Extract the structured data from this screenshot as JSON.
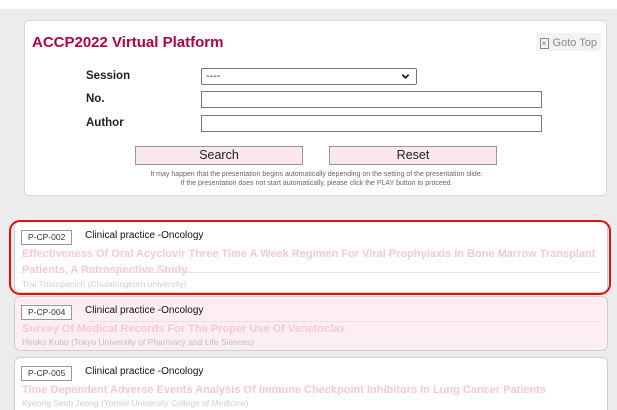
{
  "header": {
    "title": "ACCP2022 Virtual Platform",
    "goto_top": "Goto Top"
  },
  "search_form": {
    "session_label": "Session",
    "session_value": "----",
    "no_label": "No.",
    "no_value": "",
    "author_label": "Author",
    "author_value": "",
    "search_button": "Search",
    "reset_button": "Reset",
    "note_line1": "It may happen that the presentation begins automatically depending on the setting of the presentation slide.",
    "note_line2": "If the presentation does not start automatically, please click the PLAY button to proceed."
  },
  "results": [
    {
      "code": "P-CP-002",
      "category": "Clinical practice -Oncology",
      "title": "Effectiveness Of Oral Acyclovir Three Time A Week Regimen For Viral Prophylaxis In Bone Marrow Transplant Patients, A Retrospective Study.",
      "author": "Trai Thampanich  (Chulalongkorn university)",
      "highlighted": true
    },
    {
      "code": "P-CP-004",
      "category": "Clinical practice -Oncology",
      "title": "Survey Of Medical Records For The Proper Use Of Venetoclax",
      "author": "Hiroko Kubo  (Tokyo University of Pharmacy and Life Siences)",
      "highlighted": false
    },
    {
      "code": "P-CP-005",
      "category": "Clinical practice -Oncology",
      "title": "Time Dependent Adverse Events Analysis Of Immune Checkpoint Inhibitors In Lung Cancer Patients",
      "author": "Kyeong Seob Jeong  (Yonsei University College of Medicine)",
      "highlighted": false
    }
  ],
  "colors": {
    "brand": "#b3004b",
    "title_pink": "#f7c8d8",
    "button_bg": "#fbe7ef",
    "highlight_red": "#e01010"
  }
}
